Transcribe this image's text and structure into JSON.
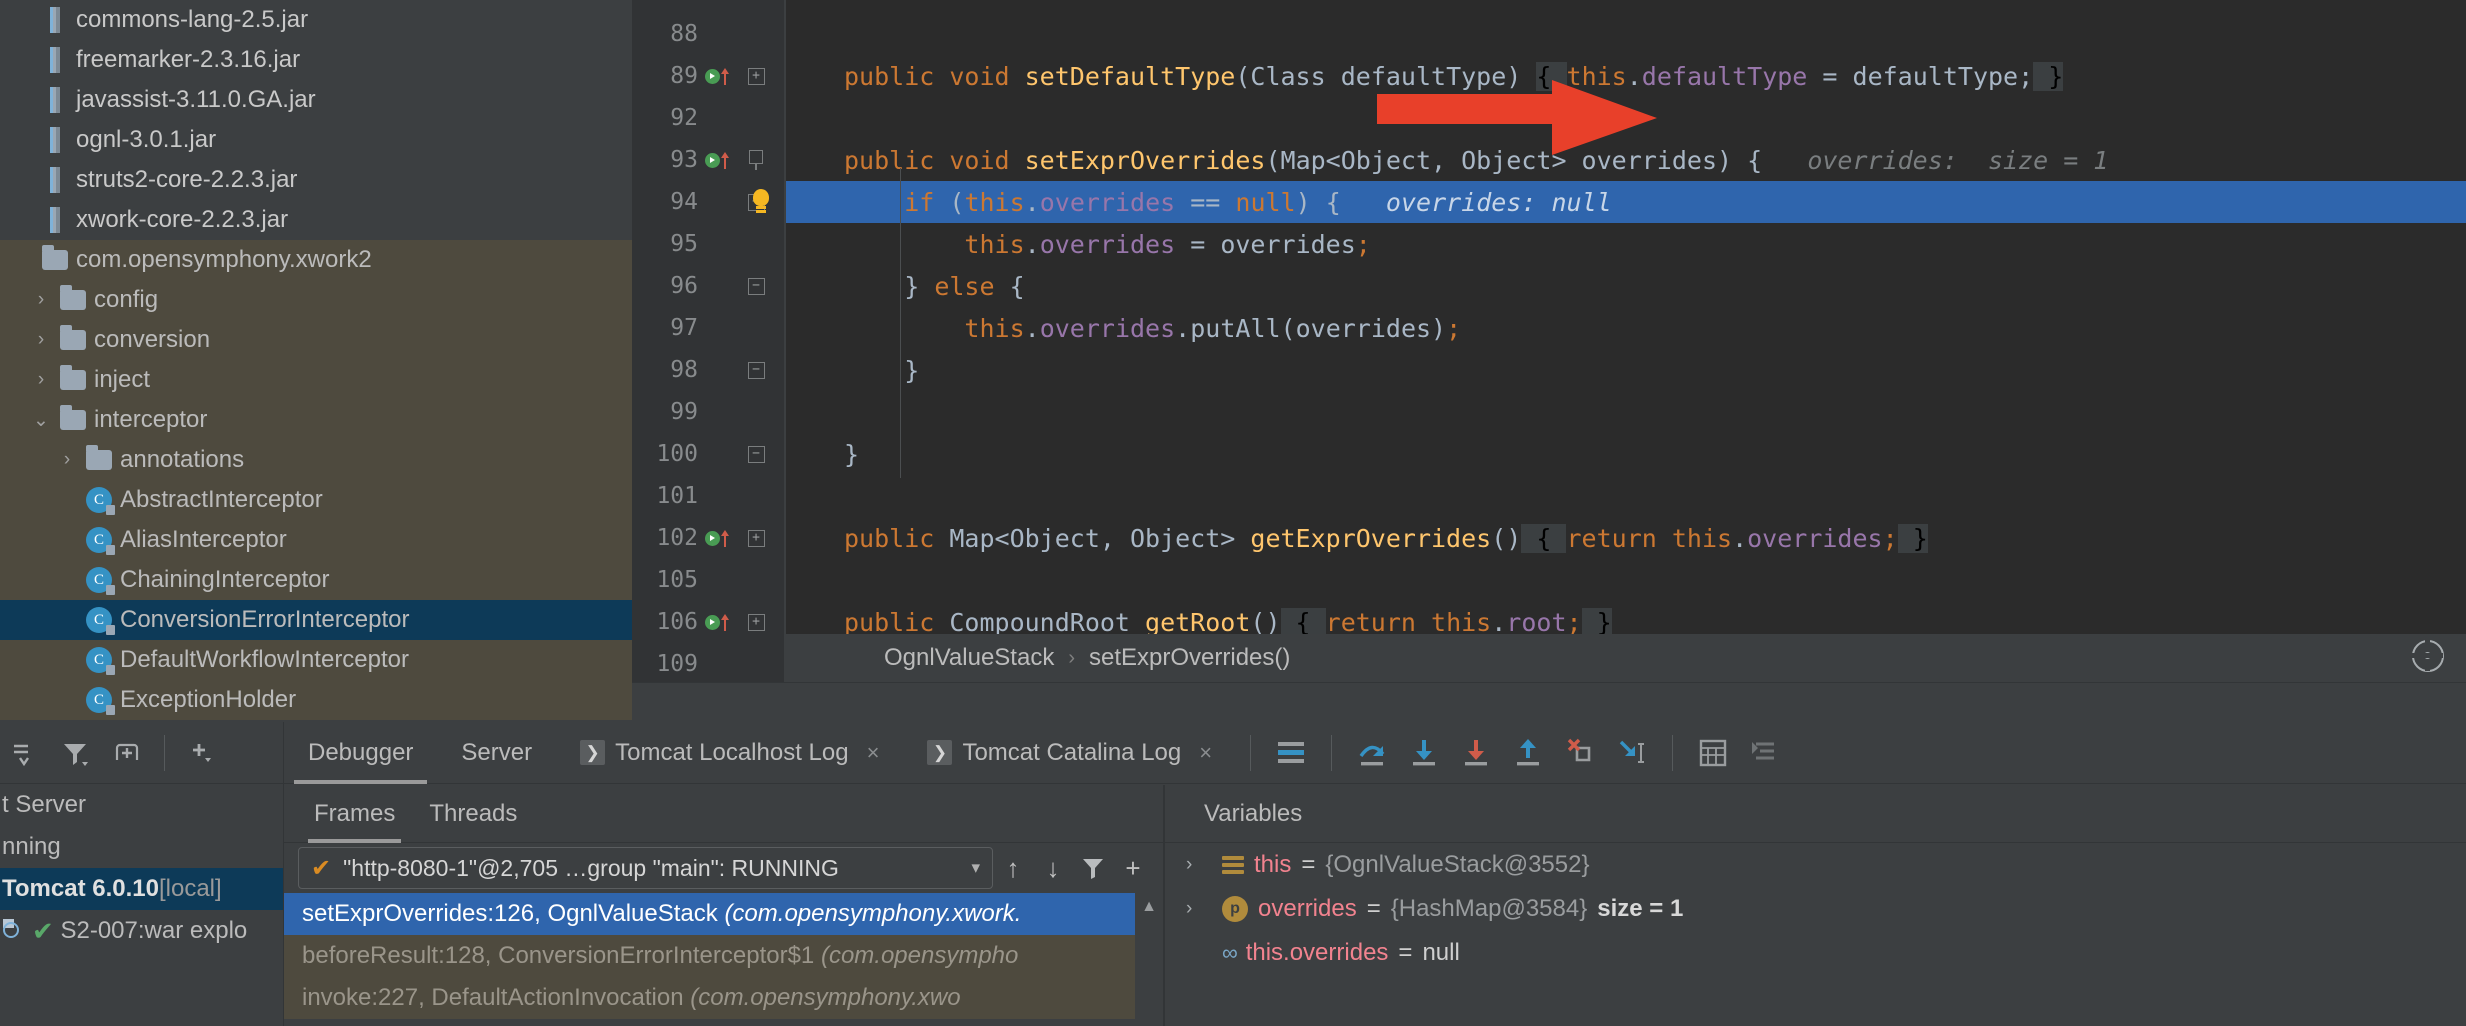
{
  "project_tree": {
    "jars": [
      {
        "label": "commons-lang-2.5.jar",
        "icon": "jar-icon"
      },
      {
        "label": "freemarker-2.3.16.jar",
        "icon": "jar-icon"
      },
      {
        "label": "javassist-3.11.0.GA.jar",
        "icon": "jar-icon"
      },
      {
        "label": "ognl-3.0.1.jar",
        "icon": "jar-icon"
      },
      {
        "label": "struts2-core-2.2.3.jar",
        "icon": "jar-icon"
      },
      {
        "label": "xwork-core-2.2.3.jar",
        "icon": "jar-icon"
      }
    ],
    "package_root": {
      "label": "com.opensymphony.xwork2",
      "icon": "folder-icon"
    },
    "packages": [
      {
        "label": "config",
        "icon": "folder-icon",
        "expanded": false,
        "arrow": "›"
      },
      {
        "label": "conversion",
        "icon": "folder-icon",
        "expanded": false,
        "arrow": "›"
      },
      {
        "label": "inject",
        "icon": "folder-icon",
        "expanded": false,
        "arrow": "›"
      },
      {
        "label": "interceptor",
        "icon": "folder-icon",
        "expanded": true,
        "arrow": "⌄"
      }
    ],
    "sub_packages": [
      {
        "label": "annotations",
        "icon": "folder-icon",
        "arrow": "›"
      }
    ],
    "classes": [
      {
        "label": "AbstractInterceptor",
        "icon": "class-icon",
        "selected": false
      },
      {
        "label": "AliasInterceptor",
        "icon": "class-icon",
        "selected": false
      },
      {
        "label": "ChainingInterceptor",
        "icon": "class-icon",
        "selected": false
      },
      {
        "label": "ConversionErrorInterceptor",
        "icon": "class-icon",
        "selected": true
      },
      {
        "label": "DefaultWorkflowInterceptor",
        "icon": "class-icon",
        "selected": false
      },
      {
        "label": "ExceptionHolder",
        "icon": "class-icon",
        "selected": false
      }
    ],
    "class_glyph": "C"
  },
  "editor": {
    "lines": [
      {
        "num": "88",
        "run": false,
        "fold": "",
        "code": []
      },
      {
        "num": "89",
        "run": true,
        "fold": "plus",
        "code": [
          {
            "t": "public ",
            "c": "k"
          },
          {
            "t": "void ",
            "c": "k"
          },
          {
            "t": "setDefaultType",
            "c": "m"
          },
          {
            "t": "(",
            "c": "t"
          },
          {
            "t": "Class",
            "c": "t"
          },
          {
            "t": " defaultType",
            "c": "t"
          },
          {
            "t": ") ",
            "c": "t"
          },
          {
            "t": "{ ",
            "c": "braceHL"
          },
          {
            "t": "this",
            "c": "k"
          },
          {
            "t": ".",
            "c": "t"
          },
          {
            "t": "defaultType",
            "c": "f"
          },
          {
            "t": " = defaultType;",
            "c": "t"
          },
          {
            "t": " }",
            "c": "braceHL"
          }
        ]
      },
      {
        "num": "92",
        "run": false,
        "fold": "",
        "code": []
      },
      {
        "num": "93",
        "run": true,
        "fold": "minus",
        "code": [
          {
            "t": "public ",
            "c": "k"
          },
          {
            "t": "void ",
            "c": "k"
          },
          {
            "t": "setExprOverrides",
            "c": "m"
          },
          {
            "t": "(",
            "c": "t"
          },
          {
            "t": "Map<Object, Object> overrides",
            "c": "t"
          },
          {
            "t": ") {",
            "c": "t"
          },
          {
            "t": "   overrides:  size = 1",
            "c": "inlay"
          }
        ]
      },
      {
        "num": "94",
        "run": false,
        "fold": "minus-bulb",
        "highlight": true,
        "code": [
          {
            "t": "    ",
            "c": "t"
          },
          {
            "t": "if ",
            "c": "k"
          },
          {
            "t": "(",
            "c": "t"
          },
          {
            "t": "this",
            "c": "k"
          },
          {
            "t": ".",
            "c": "t"
          },
          {
            "t": "overrides",
            "c": "f"
          },
          {
            "t": " == ",
            "c": "t"
          },
          {
            "t": "null",
            "c": "k"
          },
          {
            "t": ") {",
            "c": "t"
          },
          {
            "t": "   overrides: null",
            "c": "inlay"
          }
        ]
      },
      {
        "num": "95",
        "run": false,
        "fold": "",
        "code": [
          {
            "t": "        ",
            "c": "t"
          },
          {
            "t": "this",
            "c": "k"
          },
          {
            "t": ".",
            "c": "t"
          },
          {
            "t": "overrides",
            "c": "f"
          },
          {
            "t": " = overrides",
            "c": "t"
          },
          {
            "t": ";",
            "c": "k"
          }
        ]
      },
      {
        "num": "96",
        "run": false,
        "fold": "bottom",
        "code": [
          {
            "t": "    } ",
            "c": "t"
          },
          {
            "t": "else ",
            "c": "k"
          },
          {
            "t": "{",
            "c": "t"
          }
        ]
      },
      {
        "num": "97",
        "run": false,
        "fold": "",
        "code": [
          {
            "t": "        ",
            "c": "t"
          },
          {
            "t": "this",
            "c": "k"
          },
          {
            "t": ".",
            "c": "t"
          },
          {
            "t": "overrides",
            "c": "f"
          },
          {
            "t": ".",
            "c": "t"
          },
          {
            "t": "putAll",
            "c": "t"
          },
          {
            "t": "(overrides)",
            "c": "t"
          },
          {
            "t": ";",
            "c": "k"
          }
        ]
      },
      {
        "num": "98",
        "run": false,
        "fold": "bottom",
        "code": [
          {
            "t": "    }",
            "c": "t"
          }
        ]
      },
      {
        "num": "99",
        "run": false,
        "fold": "",
        "code": []
      },
      {
        "num": "100",
        "run": false,
        "fold": "bottom",
        "code": [
          {
            "t": "}",
            "c": "t"
          }
        ]
      },
      {
        "num": "101",
        "run": false,
        "fold": "",
        "code": []
      },
      {
        "num": "102",
        "run": true,
        "fold": "plus",
        "code": [
          {
            "t": "public ",
            "c": "k"
          },
          {
            "t": "Map<Object, Object> ",
            "c": "t"
          },
          {
            "t": "getExprOverrides",
            "c": "m"
          },
          {
            "t": "()",
            "c": "t"
          },
          {
            "t": " { ",
            "c": "braceHL"
          },
          {
            "t": "return ",
            "c": "k"
          },
          {
            "t": "this",
            "c": "k"
          },
          {
            "t": ".",
            "c": "t"
          },
          {
            "t": "overrides",
            "c": "f"
          },
          {
            "t": ";",
            "c": "k"
          },
          {
            "t": " }",
            "c": "braceHL"
          }
        ]
      },
      {
        "num": "105",
        "run": false,
        "fold": "",
        "code": []
      },
      {
        "num": "106",
        "run": true,
        "fold": "plus",
        "code": [
          {
            "t": "public ",
            "c": "k"
          },
          {
            "t": "CompoundRoot ",
            "c": "t"
          },
          {
            "t": "getRoot",
            "c": "m"
          },
          {
            "t": "()",
            "c": "t"
          },
          {
            "t": " { ",
            "c": "braceHL"
          },
          {
            "t": "return ",
            "c": "k"
          },
          {
            "t": "this",
            "c": "k"
          },
          {
            "t": ".",
            "c": "t"
          },
          {
            "t": "root",
            "c": "f"
          },
          {
            "t": ";",
            "c": "k"
          },
          {
            "t": " }",
            "c": "braceHL"
          }
        ]
      },
      {
        "num": "109",
        "run": false,
        "fold": "",
        "code": []
      }
    ],
    "breadcrumb": [
      "OgnlValueStack",
      "setExprOverrides()"
    ],
    "breadcrumb_separator": "›",
    "annotation": {
      "type": "red-arrow",
      "color": "#e8402a",
      "points_at": "setExprOverrides"
    }
  },
  "services_panel": {
    "toolbar_icons": [
      "collapse-icon",
      "filter-icon",
      "new-tab-icon",
      "add-icon"
    ],
    "rows": [
      {
        "label": "t Server",
        "type": "text"
      },
      {
        "label": "nning",
        "type": "text"
      },
      {
        "label": "Tomcat 6.0.10",
        "suffix": " [local]",
        "selected": true
      },
      {
        "label": "S2-007:war explo",
        "icon": "artifact-icon",
        "status": "✔",
        "selected": false
      }
    ]
  },
  "debugger": {
    "tabs": [
      {
        "label": "Debugger",
        "active": true,
        "closable": false,
        "icon": null
      },
      {
        "label": "Server",
        "active": false,
        "closable": false,
        "icon": null
      },
      {
        "label": "Tomcat Localhost Log",
        "active": false,
        "closable": true,
        "icon": "run-icon"
      },
      {
        "label": "Tomcat Catalina Log",
        "active": false,
        "closable": true,
        "icon": "run-icon"
      }
    ],
    "close_glyph": "×",
    "run_glyph": "❯",
    "toolbar": [
      {
        "name": "show-execution-point-icon"
      },
      {
        "name": "step-over-icon"
      },
      {
        "name": "step-into-icon"
      },
      {
        "name": "force-step-into-icon"
      },
      {
        "name": "step-out-icon"
      },
      {
        "name": "drop-frame-icon"
      },
      {
        "name": "run-to-cursor-icon"
      },
      {
        "name": "evaluate-expression-icon"
      },
      {
        "name": "mute-breakpoints-icon"
      }
    ],
    "frames_panel": {
      "sub_tabs": [
        {
          "label": "Frames",
          "active": true
        },
        {
          "label": "Threads",
          "active": false
        }
      ],
      "thread_selector": {
        "check": "✔",
        "value": "\"http-8080-1\"@2,705 …group \"main\": RUNNING",
        "caret": "▾"
      },
      "thread_toolbar": [
        "up-arrow-icon",
        "down-arrow-icon",
        "filter-icon",
        "plus-icon"
      ],
      "rows": [
        {
          "method": "setExprOverrides:126, OgnlValueStack",
          "pkg": "(com.opensymphony.xwork.",
          "selected": true
        },
        {
          "method": "beforeResult:128, ConversionErrorInterceptor$1",
          "pkg": "(com.opensympho",
          "selected": false
        },
        {
          "method": "invoke:227, DefaultActionInvocation",
          "pkg": "(com.opensymphony.xwo",
          "selected": false
        }
      ]
    },
    "variables_panel": {
      "title": "Variables",
      "rows": [
        {
          "arrow": "›",
          "icon": "object-icon",
          "name": "this",
          "eq": "=",
          "value": "{OgnlValueStack@3552}",
          "extra": ""
        },
        {
          "arrow": "›",
          "icon": "param-icon",
          "name": "overrides",
          "eq": "=",
          "value": "{HashMap@3584}",
          "extra": "size = 1"
        },
        {
          "arrow": "",
          "icon": "watch-icon",
          "name": "this.overrides",
          "eq": "=",
          "value": "null",
          "extra": "",
          "value_plain": true
        }
      ],
      "param_glyph": "p",
      "watch_glyph": "∞"
    }
  },
  "colors": {
    "accent_blue": "#2f65ad",
    "selection_dark": "#0d3a58",
    "package_bg": "#4e4a3e",
    "arrow_red": "#e8402a",
    "keyword_orange": "#cc7832",
    "method_yellow": "#ffc66d",
    "field_purple": "#9876aa",
    "editor_bg": "#2b2b2b",
    "panel_bg": "#3c3f41"
  }
}
